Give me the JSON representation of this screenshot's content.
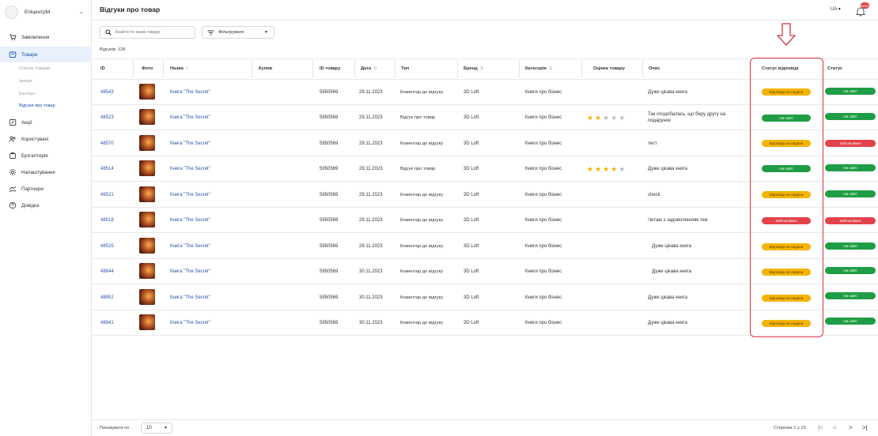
{
  "app": {
    "store_name": "ЕпіцентрМ",
    "page_title": "Відгуки про товар",
    "language": "UA",
    "notification_count": "9999"
  },
  "sidebar": {
    "items": [
      {
        "label": "Замовлення",
        "icon": "cart-icon"
      },
      {
        "label": "Товари",
        "icon": "box-icon"
      },
      {
        "label": "Акції",
        "icon": "promo-icon"
      },
      {
        "label": "Користувачі",
        "icon": "users-icon"
      },
      {
        "label": "Бухгалтерія",
        "icon": "accounting-icon"
      },
      {
        "label": "Налаштування",
        "icon": "gear-icon"
      },
      {
        "label": "Партнери",
        "icon": "handshake-icon"
      },
      {
        "label": "Довідка",
        "icon": "help-icon"
      }
    ],
    "products_submenu": [
      "Список товарів",
      "Імпорт",
      "Експорт",
      "Відгуки про товар"
    ]
  },
  "toolbar": {
    "search_placeholder": "Знайти по назві товару",
    "filter_label": "Фільтрувати",
    "count_text": "Відгуків: 128"
  },
  "table": {
    "columns": [
      "ID",
      "Фото",
      "Назва",
      "Купив",
      "ID товару",
      "Дата",
      "Тип",
      "Бренд",
      "Категорія",
      "Оцінка товару",
      "Опис",
      "Статус відповіді",
      "Статус"
    ],
    "rows": [
      {
        "id": "48543",
        "name": "Книга \"The Secret\"",
        "product_id": "5950569",
        "date": "29.11.2023",
        "type": "Коментар до відгуку",
        "brand": "3D Loft",
        "category": "Книги про бізнес",
        "rating": 0,
        "description": "Дуже цікава книга",
        "reply_status": "Відповідь не надана",
        "status": "На сайті"
      },
      {
        "id": "48523",
        "name": "Книга \"The Secret\"",
        "product_id": "5950569",
        "date": "29.11.2023",
        "type": "Відгук про товар",
        "brand": "3D Loft",
        "category": "Книги про бізнес",
        "rating": 2,
        "description": "Так сподобалась, що беру другу на подарунок",
        "reply_status": "На сайті",
        "status": "На сайті"
      },
      {
        "id": "48570",
        "name": "Книга \"The Secret\"",
        "product_id": "5950569",
        "date": "29.11.2023",
        "type": "Коментар до відгуку",
        "brand": "3D Loft",
        "category": "Книги про бізнес",
        "rating": 0,
        "description": "тест",
        "reply_status": "Відповідь не надана",
        "status": "Заблоковано"
      },
      {
        "id": "48514",
        "name": "Книга \"The Secret\"",
        "product_id": "5950569",
        "date": "29.11.2023",
        "type": "Відгук про товар",
        "brand": "3D Loft",
        "category": "Книги про бізнес",
        "rating": 4,
        "description": "Дуже цікава книга",
        "reply_status": "На сайті",
        "status": "На сайті"
      },
      {
        "id": "48521",
        "name": "Книга \"The Secret\"",
        "product_id": "5950569",
        "date": "29.11.2023",
        "type": "Коментар до відгуку",
        "brand": "3D Loft",
        "category": "Книги про бізнес",
        "rating": 0,
        "description": "check",
        "reply_status": "Відповідь не надана",
        "status": "На сайті"
      },
      {
        "id": "48518",
        "name": "Книга \"The Secret\"",
        "product_id": "5950569",
        "date": "29.11.2023",
        "type": "Коментар до відгуку",
        "brand": "3D Loft",
        "category": "Книги про бізнес",
        "rating": 0,
        "description": "Читаю з задоволенням теж",
        "reply_status": "Заблоковано",
        "status": "Заблоковано"
      },
      {
        "id": "48525",
        "name": "Книга \"The Secret\"",
        "product_id": "5950569",
        "date": "29.11.2023",
        "type": "Коментар до відгуку",
        "brand": "3D Loft",
        "category": "Книги про бізнес",
        "rating": 0,
        "description": "Дуже цікава книга",
        "reply_status": "Відповідь не надана",
        "status": "На сайті"
      },
      {
        "id": "48844",
        "name": "Книга \"The Secret\"",
        "product_id": "5950569",
        "date": "30.11.2023",
        "type": "Коментар до відгуку",
        "brand": "3D Loft",
        "category": "Книги про бізнес",
        "rating": 0,
        "description": "Дуже цікава книга",
        "reply_status": "Відповідь не надана",
        "status": "На сайті"
      },
      {
        "id": "48852",
        "name": "Книга \"The Secret\"",
        "product_id": "5950569",
        "date": "30.11.2023",
        "type": "Коментар до відгуку",
        "brand": "3D Loft",
        "category": "Книги про бізнес",
        "rating": 0,
        "description": "Дуже цікава книга",
        "reply_status": "Відповідь не надана",
        "status": "На сайті"
      },
      {
        "id": "48841",
        "name": "Книга \"The Secret\"",
        "product_id": "5950569",
        "date": "30.11.2023",
        "type": "Коментар до відгуку",
        "brand": "3D Loft",
        "category": "Книги про бізнес",
        "rating": 0,
        "description": "Дуже цікава книга",
        "reply_status": "Відповідь не надана",
        "status": "На сайті"
      }
    ]
  },
  "footer": {
    "per_page_label": "Показувати по",
    "per_page_value": "10",
    "page_info": "Сторінка 1 з 13"
  },
  "colors": {
    "accent": "#1a4fa0",
    "green": "#1f9d45",
    "orange": "#f4b400",
    "red": "#e2424a",
    "highlight": "#d5373f"
  }
}
